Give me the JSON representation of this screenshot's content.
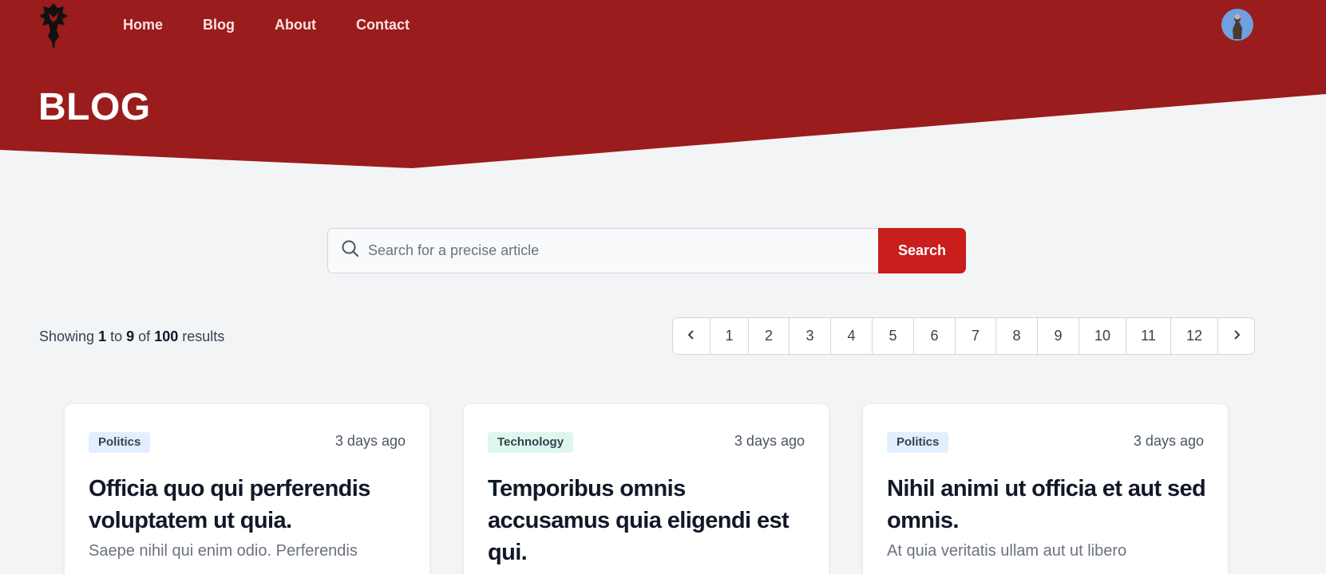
{
  "colors": {
    "brand": "#9b1c1c",
    "accent": "#c81e1e",
    "background": "#f3f4f6"
  },
  "header": {
    "logo_icon": "horde-emblem-icon",
    "nav": [
      {
        "label": "Home"
      },
      {
        "label": "Blog"
      },
      {
        "label": "About"
      },
      {
        "label": "Contact"
      }
    ],
    "avatar_icon": "user-avatar-icon"
  },
  "page_title": "BLOG",
  "search": {
    "placeholder": "Search for a precise article",
    "value": "",
    "button_label": "Search",
    "icon": "search-icon"
  },
  "results": {
    "prefix": "Showing",
    "from": "1",
    "to_word": "to",
    "to": "9",
    "of_word": "of",
    "total": "100",
    "suffix": "results"
  },
  "pagination": {
    "prev_icon": "chevron-left-icon",
    "next_icon": "chevron-right-icon",
    "pages": [
      "1",
      "2",
      "3",
      "4",
      "5",
      "6",
      "7",
      "8",
      "9",
      "10",
      "11",
      "12"
    ]
  },
  "articles": [
    {
      "category": "Politics",
      "date": "3 days ago",
      "title": "Officia quo qui perferendis voluptatem ut quia.",
      "excerpt": "Saepe nihil qui enim odio. Perferendis"
    },
    {
      "category": "Technology",
      "date": "3 days ago",
      "title": "Temporibus omnis accusamus quia eligendi est qui.",
      "excerpt": ""
    },
    {
      "category": "Politics",
      "date": "3 days ago",
      "title": "Nihil animi ut officia et aut sed omnis.",
      "excerpt": "At quia veritatis ullam aut ut libero"
    }
  ]
}
